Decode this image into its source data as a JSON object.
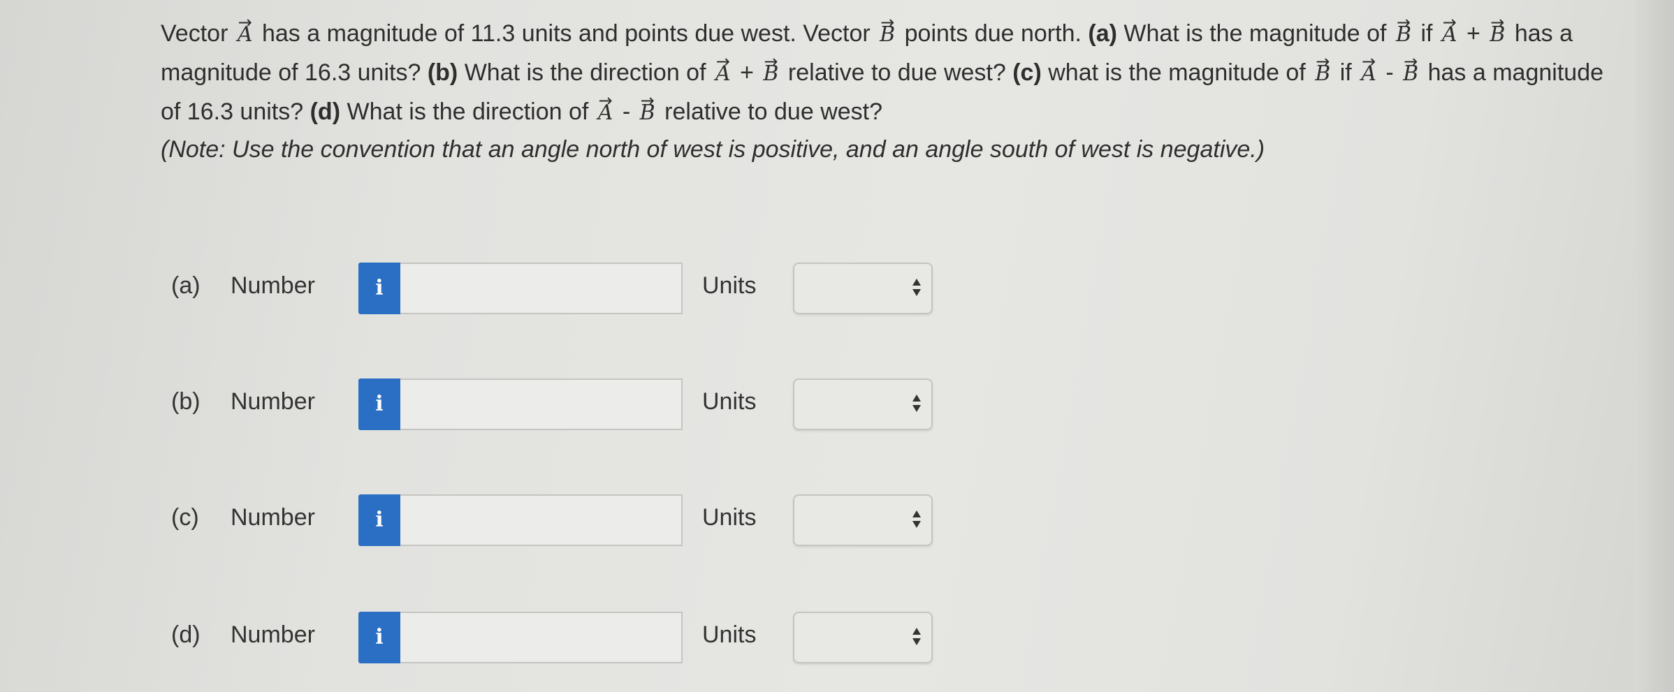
{
  "question": {
    "s1": "Vector",
    "vec_a": "A",
    "s2": "has a magnitude of 11.3 units and points due west. Vector",
    "vec_b": "B",
    "s3": "points due north.",
    "part_a": "(a)",
    "s4": "What is the magnitude of",
    "s5": "if",
    "plus": "+",
    "minus": "-",
    "s6": "has a magnitude of 16.3 units?",
    "part_b": "(b)",
    "s7": "What is the direction of",
    "s8": "relative to due west?",
    "part_c": "(c)",
    "s9": "what is the magnitude of",
    "part_d": "(d)",
    "note": "(Note: Use the convention that an angle north of west is positive, and an angle south of west is negative.)"
  },
  "rows": [
    {
      "part": "(a)",
      "label": "Number",
      "info": "i",
      "value": "",
      "units_label": "Units",
      "units_value": ""
    },
    {
      "part": "(b)",
      "label": "Number",
      "info": "i",
      "value": "",
      "units_label": "Units",
      "units_value": ""
    },
    {
      "part": "(c)",
      "label": "Number",
      "info": "i",
      "value": "",
      "units_label": "Units",
      "units_value": ""
    },
    {
      "part": "(d)",
      "label": "Number",
      "info": "i",
      "value": "",
      "units_label": "Units",
      "units_value": ""
    }
  ],
  "colors": {
    "info_button": "#2a6fc4",
    "background": "#e3e3e0"
  },
  "icons": {
    "info": "info-icon",
    "select": "up-down-arrows-icon"
  }
}
